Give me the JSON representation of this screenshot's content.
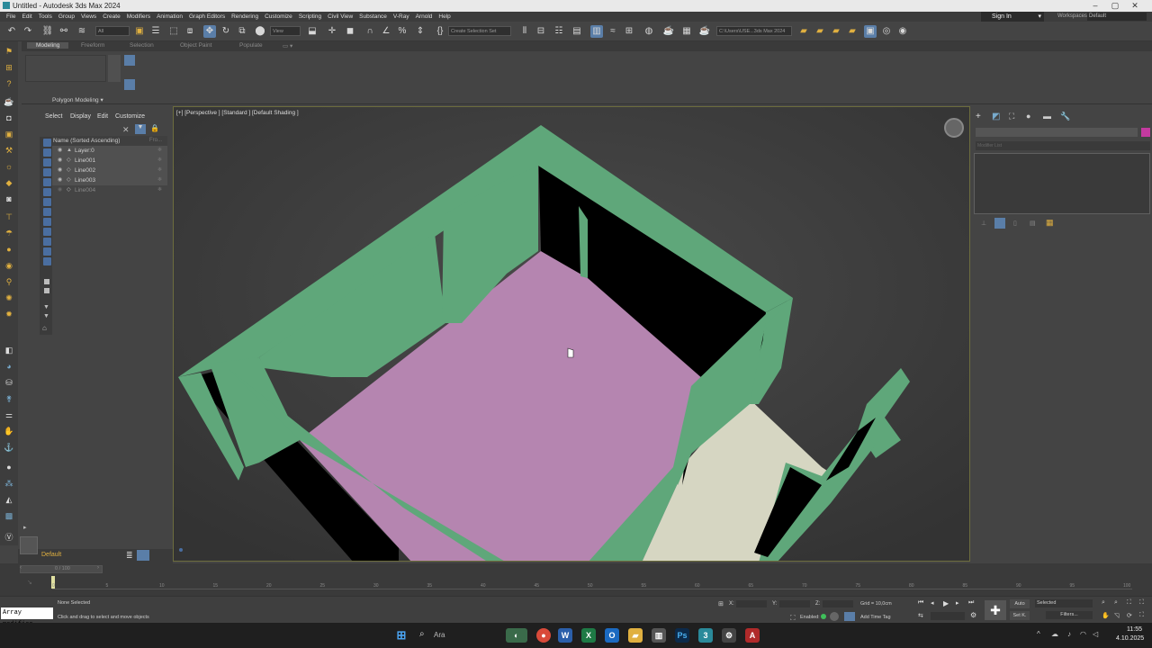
{
  "window": {
    "title": "Untitled - Autodesk 3ds Max 2024"
  },
  "menu": [
    "File",
    "Edit",
    "Tools",
    "Group",
    "Views",
    "Create",
    "Modifiers",
    "Animation",
    "Graph Editors",
    "Rendering",
    "Customize",
    "Scripting",
    "Civil View",
    "Substance",
    "V-Ray",
    "Arnold",
    "Help"
  ],
  "account": {
    "sign_in": "Sign In",
    "workspaces_label": "Workspaces:",
    "workspace": "Default"
  },
  "toolbar": {
    "filter": "All",
    "view": "View",
    "selection_set": "Create Selection Set",
    "path": "C:\\Users\\USE...3ds Max 2024"
  },
  "ribbon": {
    "tabs": [
      "Modeling",
      "Freeform",
      "Selection",
      "Object Paint",
      "Populate"
    ],
    "panel": "Polygon Modeling"
  },
  "scene_explorer": {
    "menu": [
      "Select",
      "Display",
      "Edit",
      "Customize"
    ],
    "header": "Name (Sorted Ascending)",
    "header2": "Fro...",
    "rows": [
      "Layer:0",
      "Line001",
      "Line002",
      "Line003",
      "Line004"
    ]
  },
  "layer": {
    "name": "Default",
    "frame": "0 / 100"
  },
  "viewport": {
    "label": "[+] [Perspective ] [Standard ] [Default Shading ]"
  },
  "command_panel": {
    "search": "Modifier List"
  },
  "timeline": {
    "ticks": [
      "0",
      "5",
      "10",
      "15",
      "20",
      "25",
      "30",
      "35",
      "40",
      "45",
      "50",
      "55",
      "60",
      "65",
      "70",
      "75",
      "80",
      "85",
      "90",
      "95",
      "100"
    ]
  },
  "status": {
    "maxscript": "Array modifier",
    "selection": "None Selected",
    "prompt": "Click and drag to select and move objects",
    "x_label": "X:",
    "y_label": "Y:",
    "z_label": "Z:",
    "grid": "Grid = 10,0cm",
    "enabled": "Enabled:",
    "add_time_tag": "Add Time Tag",
    "auto": "Auto",
    "set_key": "Set K.",
    "selected": "Selected",
    "filters": "Filters..."
  },
  "taskbar": {
    "search": "Ara",
    "time": "11:55",
    "date": "4.10.2025"
  },
  "colors": {
    "floor": "#b585b0",
    "walls": "#5fa77a",
    "second_floor": "#d6d6c2"
  }
}
